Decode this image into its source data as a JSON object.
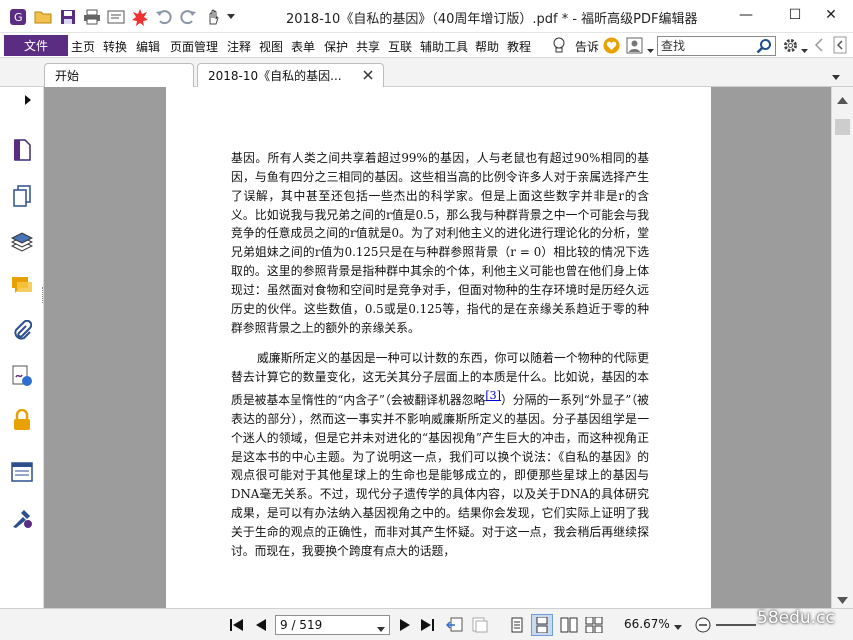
{
  "window": {
    "title": "2018-10《自私的基因》（40周年增订版）.pdf * - 福昕高级PDF编辑器",
    "min": "—",
    "max": "☐",
    "close": "✕"
  },
  "quick_access": {
    "icons": [
      "app-logo-icon",
      "open-folder-icon",
      "save-icon",
      "print-icon",
      "properties-icon",
      "burst-icon",
      "undo-icon",
      "redo-icon",
      "hand-tool-icon",
      "customize-dropdown-icon"
    ]
  },
  "menu": {
    "file": "文件",
    "items": [
      "主页",
      "转换",
      "编辑",
      "页面管理",
      "注释",
      "视图",
      "表单",
      "保护",
      "共享",
      "互联",
      "辅助工具",
      "帮助",
      "教程"
    ],
    "tell_me": "告诉",
    "search_placeholder": "查找"
  },
  "tabs": [
    {
      "label": "开始"
    },
    {
      "label": "2018-10《自私的基因..."
    }
  ],
  "sidebar": {
    "icons": [
      "pages-icon",
      "thumbnails-icon",
      "layers-icon",
      "comments-icon",
      "attachments-icon",
      "signature-icon",
      "security-icon",
      "form-fields-icon",
      "certify-icon"
    ]
  },
  "document": {
    "para1": "基因。所有人类之间共享着超过99%的基因，人与老鼠也有超过90%相同的基因，与鱼有四分之三相同的基因。这些相当高的比例令许多人对于亲属选择产生了误解，其中甚至还包括一些杰出的科学家。但是上面这些数字并非是r的含义。比如说我与我兄弟之间的r值是0.5，那么我与种群背景之中一个可能会与我竞争的任意成员之间的r值就是0。为了对利他主义的进化进行理论化的分析，堂兄弟姐妹之间的r值为0.125只是在与种群参照背景（r = 0）相比较的情况下选取的。这里的参照背景是指种群中其余的个体，利他主义可能也曾在他们身上体现过：虽然面对食物和空间时是竞争对手，但面对物种的生存环境时是历经久远历史的伙伴。这些数值，0.5或是0.125等，指代的是在亲缘关系趋近于零的种群参照背景之上的额外的亲缘关系。",
    "para2_a": "威廉斯所定义的基因是一种可以计数的东西，你可以随着一个物种的代际更替去计算它的数量变化，这无关其分子层面上的本质是什么。比如说，基因的本质是被基本呈惰性的“内含子”（会被翻译机器忽略",
    "footnote": "[3]",
    "para2_b": "）分隔的一系列“外显子”（被表达的部分），然而这一事实并不影响威廉斯所定义的基因。分子基因组学是一个迷人的领域，但是它并未对进化的“基因视角”产生巨大的冲击，而这种视角正是这本书的中心主题。为了说明这一点，我们可以换个说法：《自私的基因》的观点很可能对于其他星球上的生命也是能够成立的，即便那些星球上的基因与DNA毫无关系。不过，现代分子遗传学的具体内容，以及关于DNA的具体研究成果，是可以有办法纳入基因视角之中的。结果你会发现，它们实际上证明了我关于生命的观点的正确性，而非对其产生怀疑。对于这一点，我会稍后再继续探讨。而现在，我要换个跨度有点大的话题，"
  },
  "status": {
    "page": "9 / 519",
    "zoom": "66.67%",
    "watermark": "58edu.cc"
  },
  "colors": {
    "file_button": "#5a2d82",
    "doc_background": "#9c9c9c",
    "accent_orange": "#e8a100",
    "footnote_link": "#0000cc"
  }
}
